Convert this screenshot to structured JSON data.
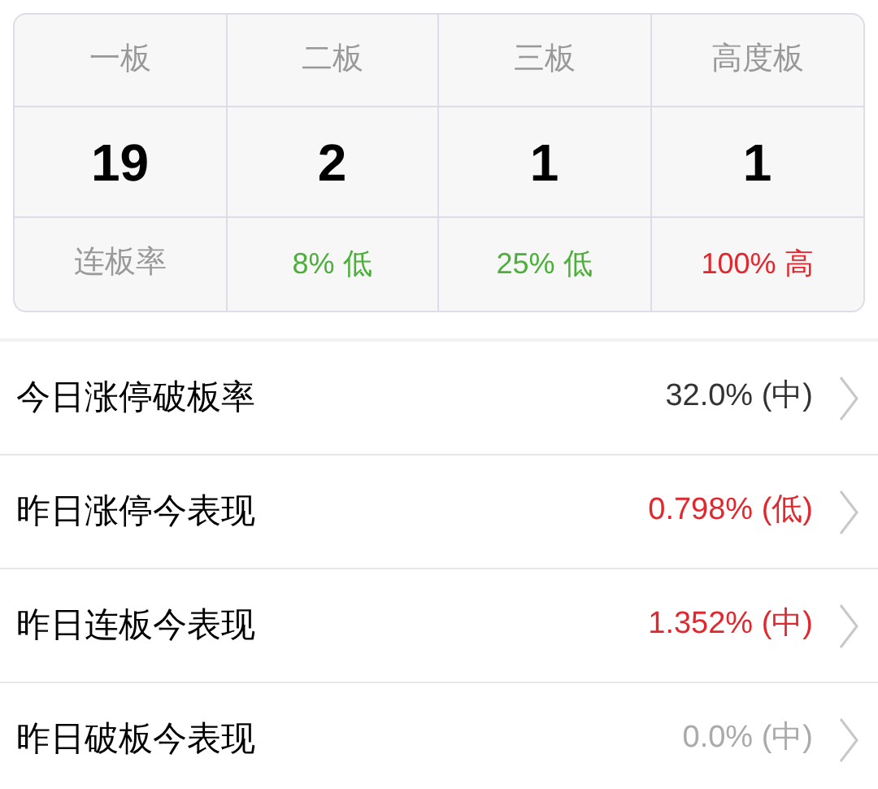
{
  "board_table": {
    "columns": [
      "一板",
      "二板",
      "三板",
      "高度板"
    ],
    "counts": [
      "19",
      "2",
      "1",
      "1"
    ],
    "rate_label": "连板率",
    "rates": [
      {
        "text": "8% 低",
        "color": "#4caf3a"
      },
      {
        "text": "25% 低",
        "color": "#4caf3a"
      },
      {
        "text": "100% 高",
        "color": "#e0282e"
      }
    ]
  },
  "rows": [
    {
      "label": "今日涨停破板率",
      "value": "32.0% (中)",
      "color": "#333333"
    },
    {
      "label": "昨日涨停今表现",
      "value": "0.798% (低)",
      "color": "#e0282e"
    },
    {
      "label": "昨日连板今表现",
      "value": "1.352% (中)",
      "color": "#e0282e"
    },
    {
      "label": "昨日破板今表现",
      "value": "0.0% (中)",
      "color": "#aaaaaa"
    }
  ]
}
